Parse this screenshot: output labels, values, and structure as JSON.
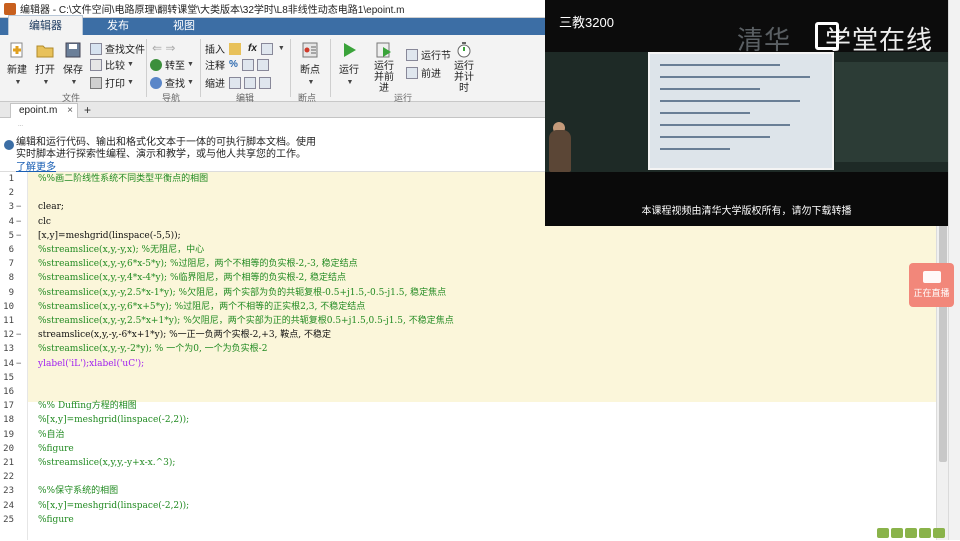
{
  "window": {
    "title": "编辑器 - C:\\文件空间\\电路原理\\翻转课堂\\大类版本\\32学时\\L8非线性动态电路1\\epoint.m"
  },
  "ribbon_tabs": [
    {
      "label": "编辑器",
      "active": true
    },
    {
      "label": "发布",
      "active": false
    },
    {
      "label": "视图",
      "active": false
    }
  ],
  "ribbon": {
    "file": {
      "new": "新建",
      "open": "打开",
      "save": "保存",
      "find_files": "查找文件",
      "compare": "比较",
      "print": "打印",
      "group": "文件"
    },
    "navigate": {
      "goto": "转至",
      "find": "查找",
      "group": "导航"
    },
    "edit": {
      "insert": "插入",
      "comment": "注释",
      "indent": "缩进",
      "fx_label": "fx",
      "group": "编辑"
    },
    "breakpoints": {
      "label": "断点",
      "group": "断点"
    },
    "run": {
      "run": "运行",
      "run_advance": "运行并前进",
      "run_section": "运行节",
      "advance": "前进",
      "run_time": "运行并计时",
      "group": "运行"
    }
  },
  "file_tab": {
    "name": "epoint.m",
    "close": "×",
    "new_tab": "+"
  },
  "info_bar": {
    "small_note": "...",
    "line1": "编辑和运行代码、输出和格式化文本于一体的可执行脚本文档。使用",
    "line2": "实时脚本进行探索性编程、演示和教学，或与他人共享您的工作。",
    "link": "了解更多"
  },
  "code_lines": [
    {
      "n": "1",
      "fold": "",
      "text": "%%画二阶线性系统不同类型平衡点的相图",
      "kind": "comment"
    },
    {
      "n": "2",
      "fold": "",
      "text": "",
      "kind": "normal"
    },
    {
      "n": "3",
      "fold": "−",
      "text": "clear;",
      "kind": "normal"
    },
    {
      "n": "4",
      "fold": "−",
      "text": "clc",
      "kind": "normal"
    },
    {
      "n": "5",
      "fold": "−",
      "text": "[x,y]=meshgrid(linspace(-5,5));",
      "kind": "normal"
    },
    {
      "n": "6",
      "fold": "",
      "text": "%streamslice(x,y,-y,x);  %无阻尼，中心",
      "kind": "comment"
    },
    {
      "n": "7",
      "fold": "",
      "text": "%streamslice(x,y,-y,6*x-5*y); %过阻尼，两个不相等的负实根-2,-3, 稳定结点",
      "kind": "comment"
    },
    {
      "n": "8",
      "fold": "",
      "text": "%streamslice(x,y,-y,4*x-4*y); %临界阻尼，两个相等的负实根-2, 稳定结点",
      "kind": "comment"
    },
    {
      "n": "9",
      "fold": "",
      "text": "%streamslice(x,y,-y,2.5*x-1*y); %欠阻尼，两个实部为负的共轭复根-0.5+j1.5,-0.5-j1.5, 稳定焦点",
      "kind": "comment"
    },
    {
      "n": "10",
      "fold": "",
      "text": "%streamslice(x,y,-y,6*x+5*y); %过阻尼，两个不相等的正实根2,3, 不稳定结点",
      "kind": "comment"
    },
    {
      "n": "11",
      "fold": "",
      "text": "%streamslice(x,y,-y,2.5*x+1*y); %欠阻尼，两个实部为正的共轭复根0.5+j1.5,0.5-j1.5, 不稳定焦点",
      "kind": "comment"
    },
    {
      "n": "12",
      "fold": "−",
      "text": "streamslice(x,y,-y,-6*x+1*y); %一正一负两个实根-2,+3, 鞍点, 不稳定",
      "kind": "mixed"
    },
    {
      "n": "13",
      "fold": "",
      "text": "%streamslice(x,y,-y,-2*y); % 一个为0, 一个为负实根-2",
      "kind": "comment"
    },
    {
      "n": "14",
      "fold": "−",
      "text": "ylabel('iL');xlabel('uC');",
      "kind": "string"
    },
    {
      "n": "15",
      "fold": "",
      "text": "",
      "kind": "normal"
    },
    {
      "n": "16",
      "fold": "",
      "text": "",
      "kind": "normal"
    },
    {
      "n": "17",
      "fold": "",
      "text": "%% Duffing方程的相图",
      "kind": "comment"
    },
    {
      "n": "18",
      "fold": "",
      "text": "%[x,y]=meshgrid(linspace(-2,2));",
      "kind": "comment"
    },
    {
      "n": "19",
      "fold": "",
      "text": "%自治",
      "kind": "comment"
    },
    {
      "n": "20",
      "fold": "",
      "text": "%figure",
      "kind": "comment"
    },
    {
      "n": "21",
      "fold": "",
      "text": "%streamslice(x,y,y,-y+x-x.^3);",
      "kind": "comment"
    },
    {
      "n": "22",
      "fold": "",
      "text": "",
      "kind": "normal"
    },
    {
      "n": "23",
      "fold": "",
      "text": "%%保守系统的相图",
      "kind": "comment"
    },
    {
      "n": "24",
      "fold": "",
      "text": "%[x,y]=meshgrid(linspace(-2,2));",
      "kind": "comment"
    },
    {
      "n": "25",
      "fold": "",
      "text": "%figure",
      "kind": "comment"
    }
  ],
  "video": {
    "hall": "三教3200",
    "brand_prefix": "清华",
    "brand": "学堂在线",
    "caption": "本课程视频由清华大学版权所有，请勿下载转播"
  },
  "live_button": {
    "label": "正在直播"
  },
  "colors": {
    "ribbon_blue": "#3c6ea5",
    "cell_highlight": "#fbf6da",
    "comment_green": "#228b22",
    "string_purple": "#a020f0",
    "live_red": "#f2877a"
  }
}
